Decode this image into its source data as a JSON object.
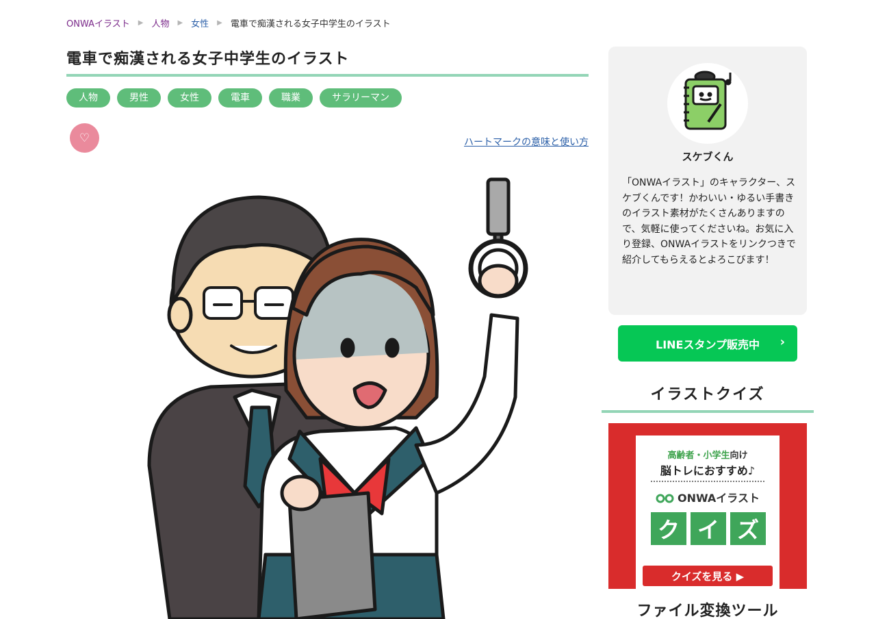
{
  "breadcrumb": {
    "home": "ONWAイラスト",
    "level1": "人物",
    "level2": "女性",
    "current": "電車で痴漢される女子中学生のイラスト"
  },
  "page": {
    "title": "電車で痴漢される女子中学生のイラスト"
  },
  "tags": [
    "人物",
    "男性",
    "女性",
    "電車",
    "職業",
    "サラリーマン"
  ],
  "heart": {
    "icon": "♡",
    "link_text": "ハートマークの意味と使い方"
  },
  "sidebar": {
    "profile": {
      "name": "スケブくん",
      "description": "「ONWAイラスト」のキャラクター、スケブくんです！かわいい・ゆるい手書きのイラスト素材がたくさんありますので、気軽に使ってくださいね。お気に入り登録、ONWAイラストをリンクつきで紹介してもらえるとよろこびます！"
    },
    "line_button": {
      "label": "LINEスタンプ販売中",
      "chevron": "›"
    },
    "quiz": {
      "heading": "イラストクイズ",
      "line1_green": "高齢者・小学生",
      "line1_suffix": "向け",
      "line2": "脳トレにおすすめ♪",
      "logo": "ONWAイラスト",
      "tiles": [
        "ク",
        "イ",
        "ズ"
      ],
      "cta": "クイズを見る ▶"
    },
    "tools_heading": "ファイル変換ツール"
  },
  "colors": {
    "accent_green": "#5fbd7a",
    "rule_mint": "#93d5b6",
    "line_green": "#06c755",
    "heart_pink": "#ea8a9c",
    "link_blue": "#2b5fa8",
    "breadcrumb_purple": "#7b2a8a",
    "curtain_red": "#d92c2c"
  }
}
